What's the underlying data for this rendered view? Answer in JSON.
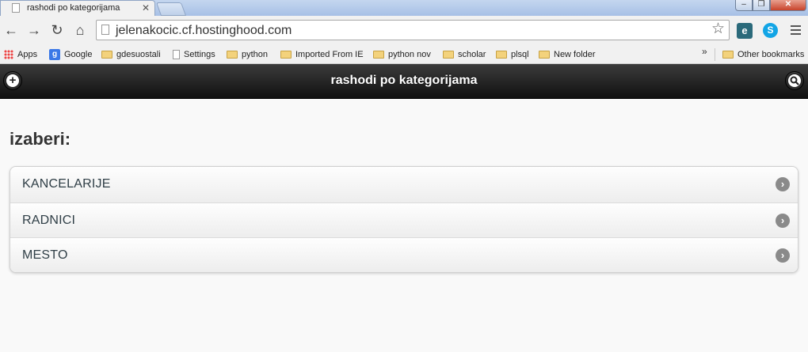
{
  "browser": {
    "tab_title": "rashodi po kategorijama",
    "url": "jelenakocic.cf.hostinghood.com",
    "bookmarks": [
      {
        "label": "Apps",
        "icon": "apps-grid-icon"
      },
      {
        "label": "Google",
        "icon": "google-icon"
      },
      {
        "label": "gdesuostali",
        "icon": "folder-icon"
      },
      {
        "label": "Settings",
        "icon": "page-icon"
      },
      {
        "label": "python",
        "icon": "folder-icon"
      },
      {
        "label": "Imported From IE",
        "icon": "folder-icon"
      },
      {
        "label": "python nov",
        "icon": "folder-icon"
      },
      {
        "label": "scholar",
        "icon": "folder-icon"
      },
      {
        "label": "plsql",
        "icon": "folder-icon"
      },
      {
        "label": "New folder",
        "icon": "folder-icon"
      }
    ],
    "more_bookmarks": "»",
    "other_bookmarks": "Other bookmarks"
  },
  "header": {
    "title": "rashodi po kategorijama",
    "left_button_icon": "plus-icon",
    "right_button_icon": "search-icon"
  },
  "main": {
    "heading": "izaberi:",
    "items": [
      {
        "label": "KANCELARIJE"
      },
      {
        "label": "RADNICI"
      },
      {
        "label": "MESTO"
      }
    ]
  },
  "colors": {
    "header_bg": "#111111",
    "page_bg": "#f9f9f9",
    "list_text": "#2f3e46",
    "arrow_icon_bg": "#8a8a8a"
  }
}
